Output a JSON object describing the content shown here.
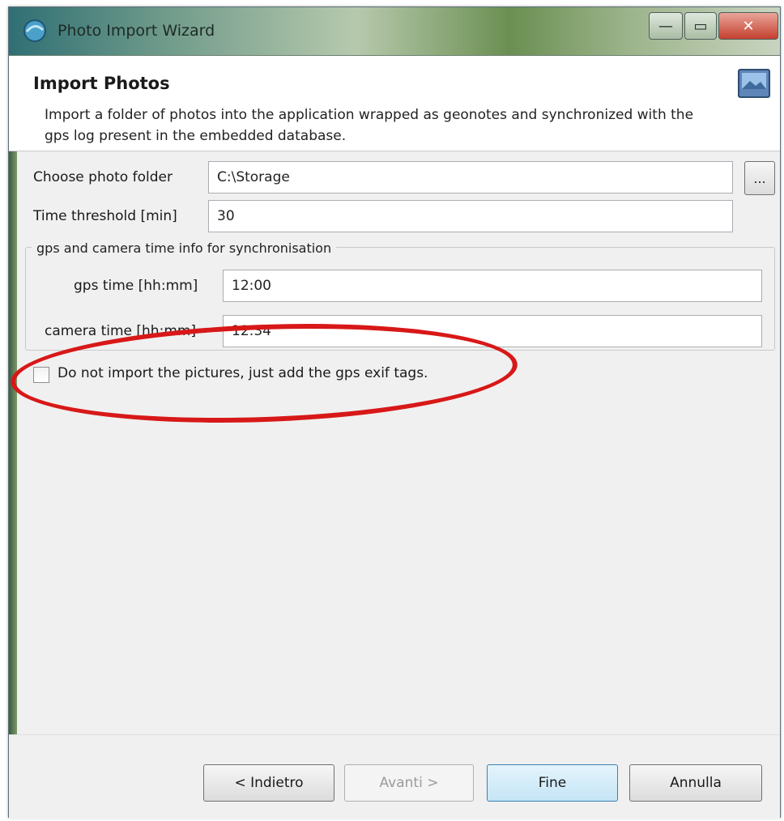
{
  "window": {
    "title": "Photo Import Wizard",
    "controls": {
      "minimize": "—",
      "maximize": "▭",
      "close": "✕"
    }
  },
  "banner": {
    "title": "Import Photos",
    "description": "Import a folder of photos into the application wrapped as geonotes and synchronized with the gps log present in the embedded database."
  },
  "form": {
    "folder_label": "Choose photo folder",
    "folder_value": "C:\\Storage",
    "browse_label": "...",
    "threshold_label": "Time threshold [min]",
    "threshold_value": "30",
    "group_label": "gps and camera time info for synchronisation",
    "gps_time_label": "gps time [hh:mm]",
    "gps_time_value": "12:00",
    "camera_time_label": "camera time [hh:mm]",
    "camera_time_value": "12:34",
    "checkbox_label": "Do not import the pictures, just add the gps exif tags.",
    "checkbox_checked": false
  },
  "footer": {
    "back_label": "< Indietro",
    "next_label": "Avanti >",
    "finish_label": "Fine",
    "cancel_label": "Annulla"
  },
  "colors": {
    "annotation": "#d81818",
    "default_button_border": "#3c7fb1"
  }
}
